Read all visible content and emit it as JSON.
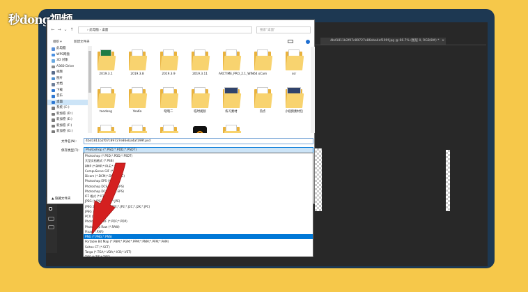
{
  "brand": {
    "logo_text": "秒dong视频"
  },
  "photoshop": {
    "doc_tab": "4bd1811b2f07c89727e86eba4af199f.jpg @ 66.7% (图层 0, RGB/8#) *",
    "close_glyph": "×"
  },
  "dialog": {
    "breadcrumb": "› 此电脑 › 桌面",
    "search_placeholder": "搜索\"桌面\"",
    "organize_label": "组织 ▾",
    "new_folder_label": "新建文件夹",
    "sidebar": [
      {
        "label": "此电脑",
        "icon": "computer-icon",
        "color": "#5a8fd6",
        "selected": false
      },
      {
        "label": "WPS网盘",
        "icon": "cloud-icon",
        "color": "#4a90e2",
        "selected": false
      },
      {
        "label": "3D 对象",
        "icon": "cube-icon",
        "color": "#6aa9e0",
        "selected": false
      },
      {
        "label": "A360 Drive",
        "icon": "drive-icon",
        "color": "#888888",
        "selected": false
      },
      {
        "label": "视频",
        "icon": "video-icon",
        "color": "#5a6d8c",
        "selected": false
      },
      {
        "label": "图片",
        "icon": "picture-icon",
        "color": "#4f8fce",
        "selected": false
      },
      {
        "label": "文档",
        "icon": "document-icon",
        "color": "#6d7f99",
        "selected": false
      },
      {
        "label": "下载",
        "icon": "download-icon",
        "color": "#2e78d2",
        "selected": false
      },
      {
        "label": "音乐",
        "icon": "music-icon",
        "color": "#2e78d2",
        "selected": false
      },
      {
        "label": "桌面",
        "icon": "desktop-icon",
        "color": "#2e78d2",
        "selected": true
      },
      {
        "label": "系统 (C:)",
        "icon": "disk-icon",
        "color": "#7a7a7a",
        "selected": false
      },
      {
        "label": "新加卷 (D:)",
        "icon": "disk-icon",
        "color": "#7a7a7a",
        "selected": false
      },
      {
        "label": "新加卷 (E:)",
        "icon": "disk-icon",
        "color": "#7a7a7a",
        "selected": false
      },
      {
        "label": "新加卷 (F:)",
        "icon": "disk-icon",
        "color": "#7a7a7a",
        "selected": false
      },
      {
        "label": "新加卷 (G:)",
        "icon": "disk-icon",
        "color": "#7a7a7a",
        "selected": false
      }
    ],
    "files": [
      {
        "label": "2019.3.1",
        "kind": "excel-folder"
      },
      {
        "label": "2019.3.8",
        "kind": "folder"
      },
      {
        "label": "2019.3.9",
        "kind": "folder"
      },
      {
        "label": "2019.3.11",
        "kind": "folder"
      },
      {
        "label": "ARCTIME_PRO_2.1_WIN64",
        "kind": "folder"
      },
      {
        "label": "oCam",
        "kind": "folder"
      },
      {
        "label": "ssr",
        "kind": "folder"
      },
      {
        "label": "taodong",
        "kind": "folder"
      },
      {
        "label": "YeaKa",
        "kind": "folder"
      },
      {
        "label": "晓晓二",
        "kind": "folder"
      },
      {
        "label": "临时视频",
        "kind": "folder"
      },
      {
        "label": "练习素材",
        "kind": "image-folder"
      },
      {
        "label": "热点",
        "kind": "folder"
      },
      {
        "label": "小视频素材包",
        "kind": "image-folder"
      },
      {
        "label": "",
        "kind": "folder"
      },
      {
        "label": "",
        "kind": "folder"
      },
      {
        "label": "",
        "kind": "folder"
      },
      {
        "label": "",
        "kind": "app-icon"
      },
      {
        "label": "",
        "kind": "folder"
      }
    ],
    "filename_label": "文件名(N):",
    "filename_value": "4bd1811b2f07c89727e86eba4af199f.psd",
    "filetype_label": "保存类型(T):",
    "filetype_value": "Photoshop (*.PSD;*.PDD;*.PSDT)",
    "hide_folders_label": "▲ 隐藏文件夹"
  },
  "dropdown": {
    "options": [
      "Photoshop (*.PSD;*.PDD;*.PSDT)",
      "大型文档格式 (*.PSB)",
      "BMP (*.BMP;*.RLE;*.DIB)",
      "CompuServe GIF (*.GIF)",
      "Dicom (*.DCM;*.DC3;*.DIC)",
      "Photoshop EPS (*.EPS)",
      "Photoshop DCS 1.0 (*.EPS)",
      "Photoshop DCS 2.0 (*.EPS)",
      "IFF 格式 (*.IFF;*.TDI)",
      "JPEG (*.JPG;*.JPEG;*.JPE)",
      "JPEG 2000 (*.JPF;*.JPX;*.JP2;*.J2C;*.J2K;*.JPC)",
      "JPEG 立体 (*.JPS)",
      "PCX (*.PCX)",
      "Photoshop PDF (*.PDF;*.PDP)",
      "Photoshop Raw (*.RAW)",
      "Pixar (*.PXR)",
      "PNG (*.PNG;*.PNS)",
      "Portable Bit Map (*.PBM;*.PGM;*.PPM;*.PNM;*.PFM;*.PAM)",
      "Scitex CT (*.SCT)",
      "Targa (*.TGA;*.VDA;*.ICB;*.VST)",
      "TIFF (*.TIF;*.TIFF)"
    ],
    "selected_index": 16
  },
  "colors": {
    "arrow": "#d42020",
    "selection": "#0078d7",
    "frame": "#1d3852",
    "background": "#f6c84a"
  }
}
